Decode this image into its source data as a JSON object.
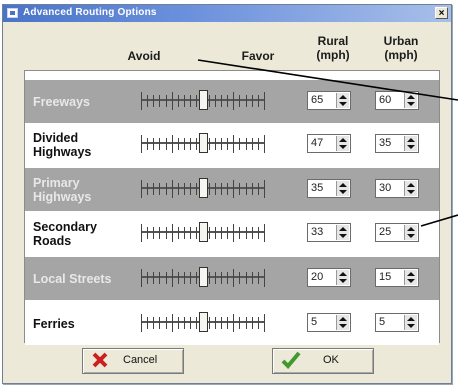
{
  "window": {
    "title": "Advanced Routing Options",
    "close_label": "×"
  },
  "headers": {
    "avoid": "Avoid",
    "favor": "Favor",
    "rural": "Rural (mph)",
    "urban": "Urban (mph)"
  },
  "rows": [
    {
      "label": "Freeways",
      "slider_level": 0.5,
      "rural": "65",
      "urban": "60"
    },
    {
      "label": "Divided Highways",
      "slider_level": 0.5,
      "rural": "47",
      "urban": "35"
    },
    {
      "label": "Primary Highways",
      "slider_level": 0.5,
      "rural": "35",
      "urban": "30"
    },
    {
      "label": "Secondary Roads",
      "slider_level": 0.5,
      "rural": "33",
      "urban": "25"
    },
    {
      "label": "Local Streets",
      "slider_level": 0.5,
      "rural": "20",
      "urban": "15"
    },
    {
      "label": "Ferries",
      "slider_level": 0.5,
      "rural": "5",
      "urban": "5"
    }
  ],
  "buttons": {
    "cancel": "Cancel",
    "ok": "OK"
  },
  "colors": {
    "shaded_row": "#a5a5a5",
    "cancel_icon": "#cc1f1f",
    "ok_icon": "#3f9a2e"
  }
}
